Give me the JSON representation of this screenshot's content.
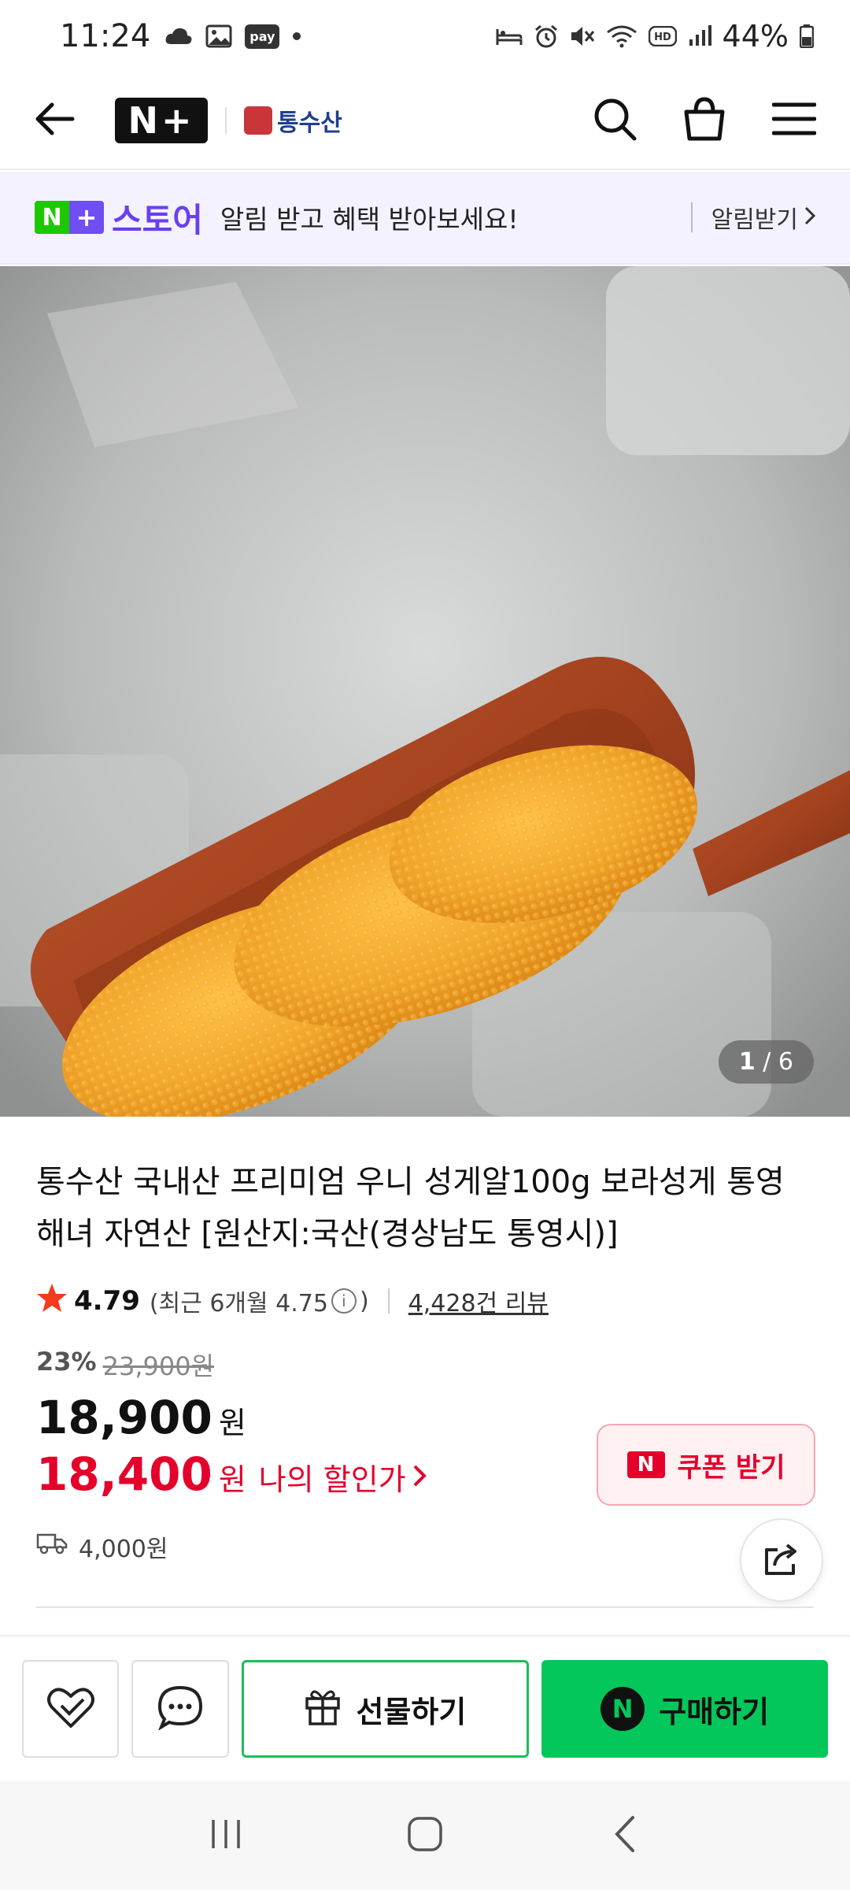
{
  "status_bar": {
    "time": "11:24",
    "pay_badge": "pay",
    "battery": "44%",
    "icons": [
      "cloud-icon",
      "gallery-icon",
      "pay-icon",
      "dot-icon",
      "bed-icon",
      "alarm-icon",
      "mute-icon",
      "wifi-icon",
      "hd-icon",
      "signal-icon",
      "battery-icon"
    ]
  },
  "header": {
    "logo_text": "N+",
    "brand_name": "통수산",
    "icons": [
      "back-arrow-icon",
      "search-icon",
      "cart-icon",
      "menu-icon"
    ]
  },
  "store_banner": {
    "store_label": "스토어",
    "message": "알림 받고 혜택 받아보세요!",
    "cta": "알림받기"
  },
  "hero": {
    "page_current": "1",
    "page_total": "/ 6"
  },
  "product": {
    "title": "통수산 국내산 프리미엄 우니 성게알100g 보라성게 통영 해녀 자연산 [원산지:국산(경상남도 통영시)]",
    "rating": "4.79",
    "recent_rating": "(최근 6개월 4.75",
    "recent_close": ")",
    "reviews": "4,428건 리뷰",
    "discount_pct": "23%",
    "original_price": "23,900원",
    "price": "18,900",
    "price_unit": "원",
    "my_price": "18,400",
    "my_price_unit": "원",
    "my_price_label": "나의 할인가",
    "coupon_label": "쿠폰 받기",
    "shipping": "4,000원"
  },
  "actions": {
    "gift_label": "선물하기",
    "buy_label": "구매하기"
  },
  "colors": {
    "naver_green": "#03c75a",
    "sale_red": "#e4002b",
    "store_purple": "#6a3ff0"
  }
}
